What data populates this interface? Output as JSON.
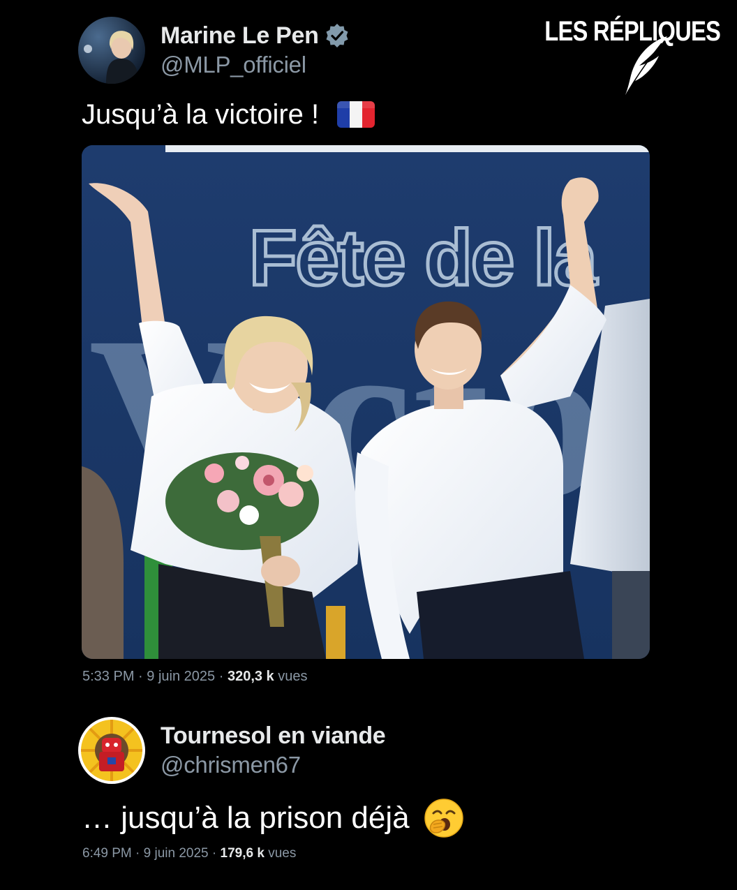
{
  "watermark": {
    "brand": "LES RÉPLIQUES",
    "icon": "quill-icon"
  },
  "tweets": [
    {
      "author": {
        "display_name": "Marine Le Pen",
        "handle": "@MLP_officiel",
        "verified": true,
        "verified_icon": "verified-badge-icon"
      },
      "text": "Jusqu’à la victoire !",
      "emoji": "france-flag-icon",
      "media": {
        "banner_line1": "Fête de la",
        "banner_line2": "Victoire",
        "description_icon": "photo"
      },
      "meta": {
        "time": "5:33 PM",
        "sep1": "·",
        "date": "9 juin 2025",
        "sep2": "·",
        "views_count": "320,3 k",
        "views_label": "vues"
      }
    },
    {
      "author": {
        "display_name": "Tournesol en viande",
        "handle": "@chrismen67"
      },
      "text": "… jusqu’à la prison déjà",
      "emoji": "yawning-face-icon",
      "meta": {
        "time": "6:49 PM",
        "sep1": "·",
        "date": "9 juin 2025",
        "sep2": "·",
        "views_count": "179,6 k",
        "views_label": "vues"
      }
    }
  ],
  "colors": {
    "background": "#000000",
    "verified_badge": "#829aab",
    "secondary_text": "#8b98a5",
    "banner_blue": "#1c3b6b"
  }
}
